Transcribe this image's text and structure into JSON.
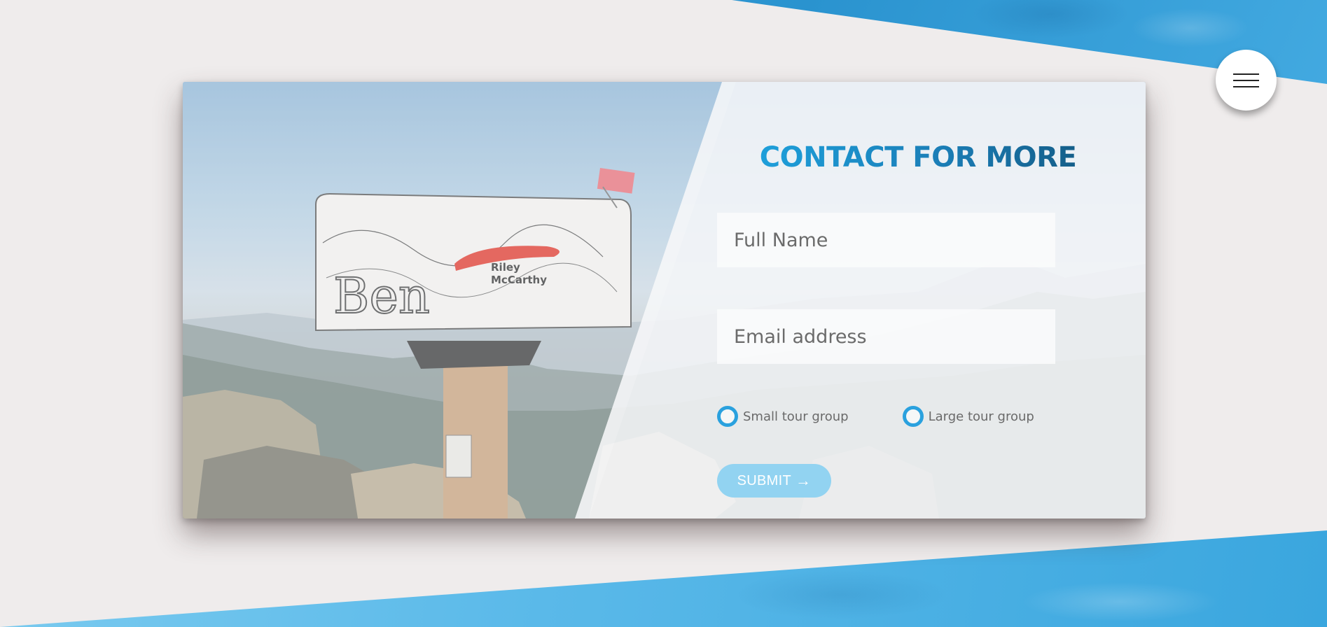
{
  "contact": {
    "title": "CONTACT FOR MORE",
    "name_placeholder": "Full Name",
    "email_placeholder": "Email address",
    "options": [
      {
        "label": "Small tour group"
      },
      {
        "label": "Large tour group"
      }
    ],
    "submit_label": "SUBMIT",
    "submit_arrow": "→"
  },
  "mailbox": {
    "names": [
      "Riley",
      "McCarthy"
    ]
  },
  "menu": {
    "icon": "hamburger-menu-icon"
  },
  "colors": {
    "accent": "#2aa1de",
    "title_dark": "#145c86",
    "submit_bg": "#92d3f1",
    "background": "#efecec"
  }
}
